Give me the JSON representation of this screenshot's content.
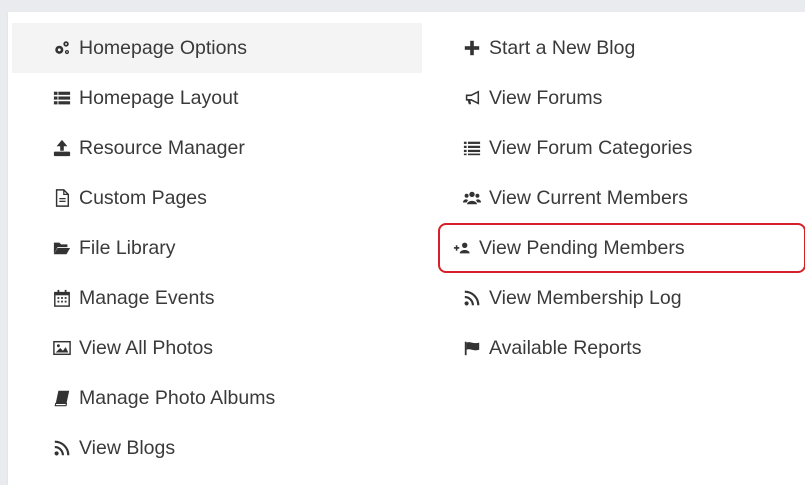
{
  "menu": {
    "left": [
      {
        "label": "Homepage Options",
        "icon": "cogs-icon",
        "active": true
      },
      {
        "label": "Homepage Layout",
        "icon": "list-icon"
      },
      {
        "label": "Resource Manager",
        "icon": "upload-icon"
      },
      {
        "label": "Custom Pages",
        "icon": "file-icon"
      },
      {
        "label": "File Library",
        "icon": "folder-open-icon"
      },
      {
        "label": "Manage Events",
        "icon": "calendar-icon"
      },
      {
        "label": "View All Photos",
        "icon": "image-icon"
      },
      {
        "label": "Manage Photo Albums",
        "icon": "book-icon"
      },
      {
        "label": "View Blogs",
        "icon": "rss-icon"
      }
    ],
    "right": [
      {
        "label": "Start a New Blog",
        "icon": "plus-icon"
      },
      {
        "label": "View Forums",
        "icon": "bullhorn-icon"
      },
      {
        "label": "View Forum Categories",
        "icon": "list-icon"
      },
      {
        "label": "View Current Members",
        "icon": "users-icon"
      },
      {
        "label": "View Pending Members",
        "icon": "user-plus-icon",
        "highlighted": true
      },
      {
        "label": "View Membership Log",
        "icon": "rss-icon"
      },
      {
        "label": "Available Reports",
        "icon": "flag-icon"
      }
    ]
  },
  "colors": {
    "highlight_border": "#d42027",
    "active_bg": "#f4f4f4"
  }
}
